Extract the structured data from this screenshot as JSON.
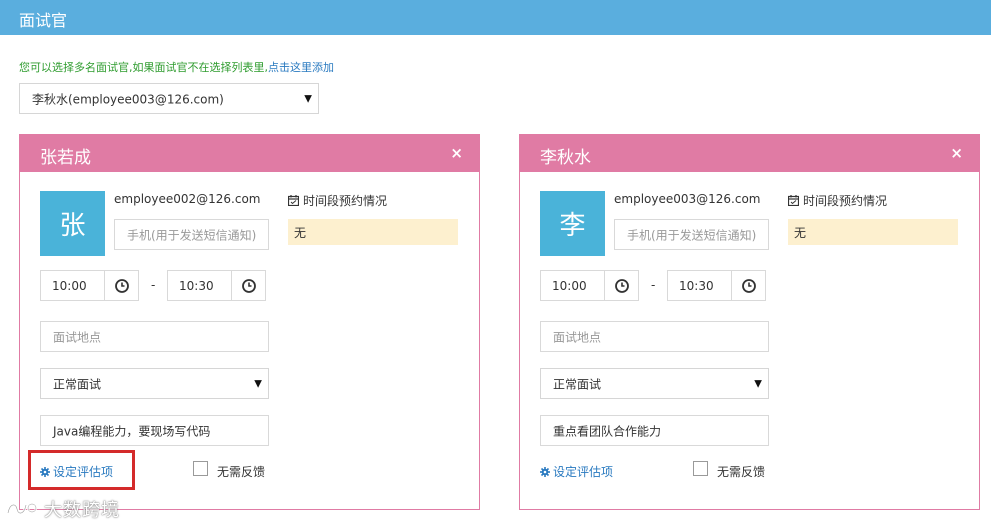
{
  "header": {
    "title": "面试官"
  },
  "hint": {
    "text": "您可以选择多名面试官,如果面试官不在选择列表里,",
    "link": "点击这里添加"
  },
  "interviewer_select": {
    "value": "李秋水(employee003@126.com)"
  },
  "cards": [
    {
      "name": "张若成",
      "close": "×",
      "avatar_char": "张",
      "email": "employee002@126.com",
      "phone_placeholder": "手机(用于发送短信通知)",
      "slot_label": "时间段预约情况",
      "slot_value": "无",
      "start_time": "10:00",
      "dash": "-",
      "end_time": "10:30",
      "location_placeholder": "面试地点",
      "interview_type": "正常面试",
      "note": "Java编程能力，要现场写代码",
      "eval_label": "设定评估项",
      "no_feedback_label": "无需反馈"
    },
    {
      "name": "李秋水",
      "close": "×",
      "avatar_char": "李",
      "email": "employee003@126.com",
      "phone_placeholder": "手机(用于发送短信通知)",
      "slot_label": "时间段预约情况",
      "slot_value": "无",
      "start_time": "10:00",
      "dash": "-",
      "end_time": "10:30",
      "location_placeholder": "面试地点",
      "interview_type": "正常面试",
      "note": "重点看团队合作能力",
      "eval_label": "设定评估项",
      "no_feedback_label": "无需反馈"
    }
  ],
  "watermark": {
    "text": "大数跨境"
  },
  "colors": {
    "header": "#5aaede",
    "card_accent": "#e07ba4",
    "avatar": "#4ab3d9",
    "slot_bg": "#fdf0cf",
    "highlight": "#d42a2a",
    "link": "#2a7ac0",
    "hint": "#2f9c2f"
  }
}
